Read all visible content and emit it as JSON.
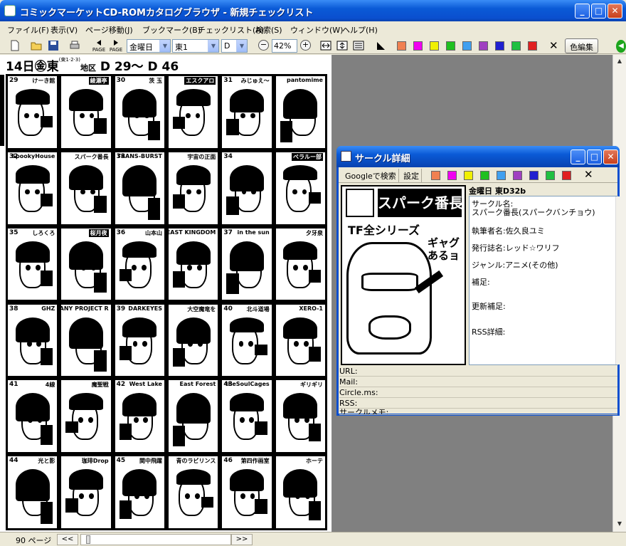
{
  "window": {
    "title": "コミックマーケットCD-ROMカタログブラウザ - 新規チェックリスト",
    "min": "_",
    "max": "□",
    "close": "✕"
  },
  "menu": [
    "ファイル(F)",
    "表示(V)",
    "ページ移動(J)",
    "ブックマーク(B)",
    "チェックリスト(A)",
    "検索(S)",
    "ウィンドウ(W)",
    "ヘルプ(H)"
  ],
  "toolbar": {
    "page_prev": "PAGE",
    "page_next": "PAGE",
    "day_select": "金曜日",
    "hall_select": "東1",
    "block_select": "D",
    "zoom_out": "−",
    "zoom_value": "42%",
    "zoom_in": "+",
    "clear": "✕",
    "color_edit": "色編集",
    "colors": [
      "#f08050",
      "#f000f0",
      "#f0f000",
      "#20c020",
      "#40a0f0",
      "#a040c0",
      "#2020d0",
      "#20c040",
      "#e02020"
    ]
  },
  "catalog": {
    "header_day": "14日㊎東",
    "header_sub": "(東1·2·3)",
    "header_area": "地区",
    "header_range": "D 29〜 D 46",
    "cells": [
      {
        "num": "29",
        "label": "けーき館",
        "inv": false
      },
      {
        "num": "",
        "label": "綾瀬亭",
        "inv": true
      },
      {
        "num": "30",
        "label": "茨 玉",
        "inv": false
      },
      {
        "num": "",
        "label": "エスクアロ",
        "inv": true
      },
      {
        "num": "31",
        "label": "みじゅえ〜",
        "inv": false
      },
      {
        "num": "",
        "label": "pantomime",
        "inv": false
      },
      {
        "num": "32",
        "label": "SpookyHouse",
        "inv": false
      },
      {
        "num": "",
        "label": "スパーク番長",
        "inv": false
      },
      {
        "num": "33",
        "label": "TRANS-BURST",
        "inv": false
      },
      {
        "num": "",
        "label": "宇宙の正面",
        "inv": false
      },
      {
        "num": "34",
        "label": "",
        "inv": false
      },
      {
        "num": "",
        "label": "ベラルー部",
        "inv": true
      },
      {
        "num": "35",
        "label": "しろくろ",
        "inv": false
      },
      {
        "num": "",
        "label": "桜月夜",
        "inv": true
      },
      {
        "num": "36",
        "label": "山本山",
        "inv": false
      },
      {
        "num": "",
        "label": "BEAST KINGDOM",
        "inv": false
      },
      {
        "num": "37",
        "label": "in the sun",
        "inv": false
      },
      {
        "num": "",
        "label": "夕牙泉",
        "inv": false
      },
      {
        "num": "38",
        "label": "GHZ",
        "inv": false
      },
      {
        "num": "",
        "label": "LAZY COMPANY PROJECT R",
        "inv": false
      },
      {
        "num": "39",
        "label": "DARKEYES",
        "inv": false
      },
      {
        "num": "",
        "label": "大空魔竜を",
        "inv": false
      },
      {
        "num": "40",
        "label": "北斗道場",
        "inv": false
      },
      {
        "num": "",
        "label": "XERO-1",
        "inv": false
      },
      {
        "num": "41",
        "label": "4線",
        "inv": false
      },
      {
        "num": "",
        "label": "魔聖戦",
        "inv": false
      },
      {
        "num": "42",
        "label": "West Lake",
        "inv": false
      },
      {
        "num": "",
        "label": "East Forest",
        "inv": false
      },
      {
        "num": "43",
        "label": "theSoulCages",
        "inv": false
      },
      {
        "num": "",
        "label": "ギリギリ",
        "inv": false
      },
      {
        "num": "44",
        "label": "光と影",
        "inv": false
      },
      {
        "num": "",
        "label": "珈琲Drop",
        "inv": false
      },
      {
        "num": "45",
        "label": "関中飛躍",
        "inv": false
      },
      {
        "num": "",
        "label": "青のラビリンス",
        "inv": false
      },
      {
        "num": "46",
        "label": "第四作画室",
        "inv": false
      },
      {
        "num": "",
        "label": "ホーテ",
        "inv": false
      }
    ]
  },
  "status": {
    "pages": "90 ページ",
    "prev": "<<",
    "next": ">>"
  },
  "popup": {
    "title": "サークル詳細",
    "search_button": "Googleで検索",
    "settings_button": "設定",
    "clear": "✕",
    "day_line": "金曜日 東D32b",
    "image_banner": "スパーク番長",
    "image_tf": "TF全シリーズ",
    "image_gag": "ギャグあるョ",
    "details": [
      "サークル名:",
      "スパーク番長(スパークバンチョウ)",
      "執筆者名:佐久良ユミ",
      "発行誌名:レッド☆ワリフ",
      "ジャンル:アニメ(その他)",
      "補足:",
      "更新補足:",
      "RSS詳細:"
    ],
    "fields": [
      "URL:",
      "Mail:",
      "Circle.ms:",
      "RSS:",
      "サークルメモ:"
    ]
  }
}
